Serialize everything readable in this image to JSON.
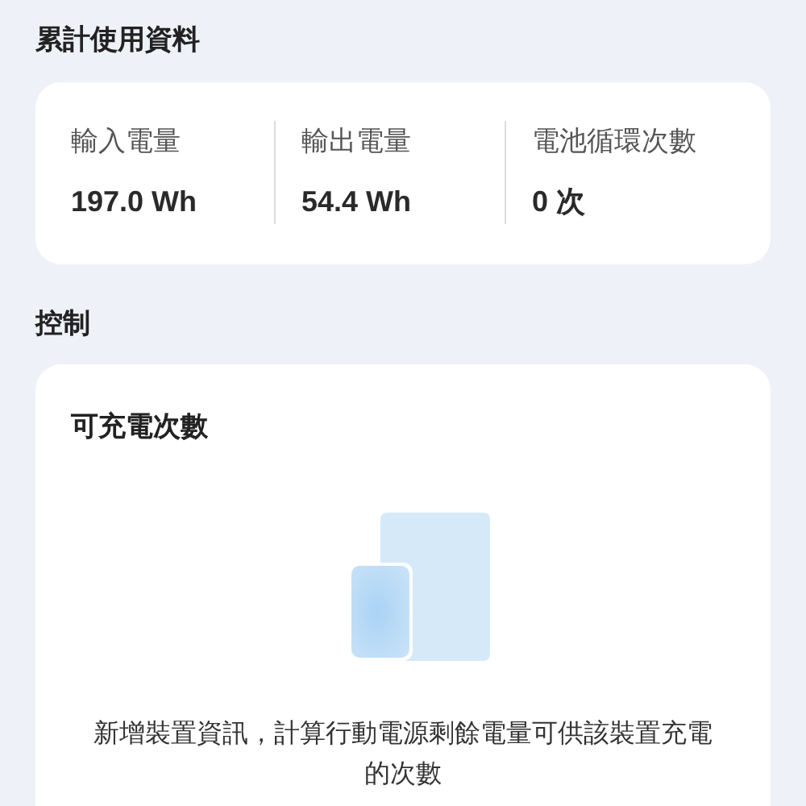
{
  "usage_section": {
    "title": "累計使用資料",
    "stats": [
      {
        "label": "輸入電量",
        "value": "197.0 Wh"
      },
      {
        "label": "輸出電量",
        "value": "54.4 Wh"
      },
      {
        "label": "電池循環次數",
        "value": "0 次"
      }
    ]
  },
  "control_section": {
    "title": "控制",
    "card": {
      "title": "可充電次數",
      "description": "新增裝置資訊，計算行動電源剩餘電量可供該裝置充電的次數"
    }
  }
}
